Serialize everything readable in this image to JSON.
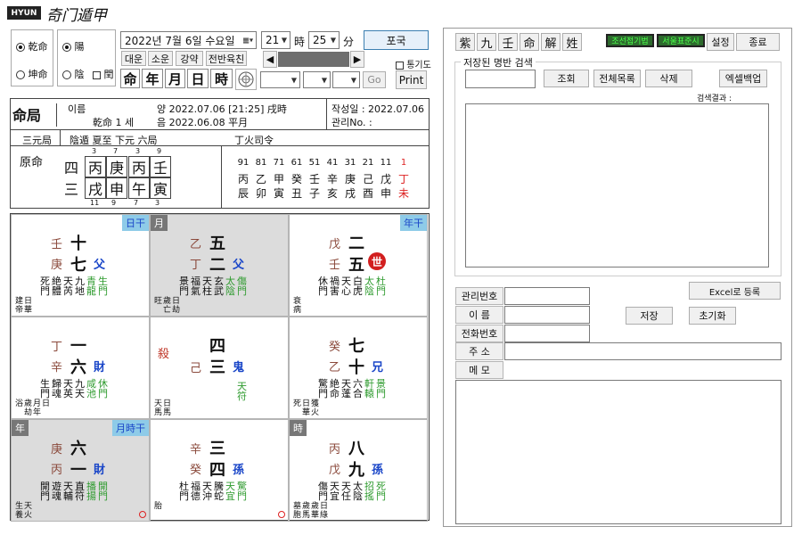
{
  "app": {
    "logo": "HYUN",
    "title": "奇门遁甲"
  },
  "radio": {
    "male": "乾命",
    "female": "坤命",
    "yang": "陽",
    "yin": "陰",
    "leap": "閏"
  },
  "date": {
    "value": "2022년  7월  6일 수요일",
    "hour": "21",
    "hour_unit": "時",
    "minute": "25",
    "minute_unit": "分"
  },
  "buttons": {
    "pokuk": "포국",
    "daewoon": "대운",
    "sowoon": "소운",
    "gangyak": "강약",
    "jeonban": "전반육친",
    "myeong": "命",
    "nyeon": "年",
    "wol": "月",
    "il": "日",
    "si": "時",
    "go": "Go",
    "print": "Print",
    "tonggi": "통기도"
  },
  "right_top": {
    "tabs": [
      "紫",
      "九",
      "壬",
      "命",
      "解",
      "姓"
    ],
    "green1": "조선접기법",
    "green2": "서울표준시",
    "settings": "설정",
    "exit": "종료"
  },
  "search": {
    "title": "저장된 명반 검색",
    "query": "조회",
    "all": "전체목록",
    "delete": "삭제",
    "excel_backup": "엑셀백업",
    "result_label": "검색결과 :"
  },
  "form": {
    "excel_register": "Excel로 등록",
    "save": "저장",
    "reset": "초기화",
    "fields": [
      "관리번호",
      "이    름",
      "전화번호",
      "주    소",
      "메    모"
    ]
  },
  "header": {
    "title": "命局",
    "name_label": "이름",
    "line1": "양 2022.07.06 [21:25] 戌時",
    "line2a": "乾命 1 세",
    "line2b": "음 2022.06.08 平月",
    "created": "작성일 : 2022.07.06",
    "manage": "관리No. :"
  },
  "row2": {
    "sanyuan": "三元局",
    "ju": "陰遁 夏至 下元 六局",
    "siling": "丁火司令"
  },
  "pillars": {
    "label": "原命",
    "top": [
      "四",
      "丙",
      "庚",
      "丙",
      "壬"
    ],
    "bottom": [
      "三",
      "戌",
      "申",
      "午",
      "寅"
    ],
    "top_nums": [
      "3",
      "7",
      "3",
      "9"
    ],
    "bottom_nums": [
      "11",
      "9",
      "7",
      "3"
    ]
  },
  "luck": {
    "ages": [
      "91",
      "81",
      "71",
      "61",
      "51",
      "41",
      "31",
      "21",
      "11",
      "1"
    ],
    "stems": [
      "丙",
      "乙",
      "甲",
      "癸",
      "壬",
      "辛",
      "庚",
      "己",
      "戊",
      "丁"
    ],
    "branches": [
      "辰",
      "卯",
      "寅",
      "丑",
      "子",
      "亥",
      "戌",
      "酉",
      "申",
      "未"
    ]
  },
  "palaces": [
    {
      "tags": [
        "日干"
      ],
      "s1": "壬",
      "s2": "庚",
      "n1": "十",
      "n2": "七",
      "rel": "父",
      "cols": [
        [
          "死",
          "門"
        ],
        [
          "絶",
          "體"
        ],
        [
          "天",
          "芮"
        ],
        [
          "九",
          "地"
        ],
        [
          "青",
          "龍"
        ],
        [
          "生",
          "門"
        ]
      ],
      "bottom": [
        [
          "建",
          "帝"
        ],
        [
          "日",
          "華"
        ]
      ]
    },
    {
      "tags": [
        "月"
      ],
      "s1": "乙",
      "s2": "丁",
      "n1": "五",
      "n2": "二",
      "rel": "父",
      "cols": [
        [
          "景",
          "門"
        ],
        [
          "福",
          "氣"
        ],
        [
          "天",
          "柱"
        ],
        [
          "玄",
          "武"
        ],
        [
          "太",
          "陰"
        ],
        [
          "傷",
          "門"
        ]
      ],
      "bottom": [
        [
          "旺",
          ""
        ],
        [
          "歲",
          "亡"
        ],
        [
          "日",
          "劫"
        ]
      ]
    },
    {
      "tags": [
        "年干"
      ],
      "s1": "戊",
      "s2": "壬",
      "n1": "二",
      "n2": "五",
      "rel": "世",
      "cols": [
        [
          "休",
          "門"
        ],
        [
          "禍",
          "害"
        ],
        [
          "天",
          "心"
        ],
        [
          "白",
          "虎"
        ],
        [
          "太",
          "陰"
        ],
        [
          "杜",
          "門"
        ]
      ],
      "bottom": [
        [
          "衰",
          "病"
        ]
      ]
    },
    {
      "tags": [],
      "s1": "丁",
      "s2": "辛",
      "n1": "一",
      "n2": "六",
      "rel": "財",
      "cols": [
        [
          "生",
          "門"
        ],
        [
          "歸",
          "魂"
        ],
        [
          "天",
          "英"
        ],
        [
          "九",
          "天"
        ],
        [
          "咸",
          "池"
        ],
        [
          "休",
          "門"
        ]
      ],
      "bottom": [
        [
          "浴",
          ""
        ],
        [
          "歲",
          "劫"
        ],
        [
          "月",
          "年"
        ],
        [
          "日",
          ""
        ]
      ]
    },
    {
      "tags": [],
      "s1": "殺",
      "s2": "己",
      "n1": "四",
      "n2": "三",
      "rel": "鬼",
      "cols": [
        [
          "天",
          "符"
        ]
      ],
      "bottom": [
        [
          "天",
          "馬"
        ],
        [
          "日",
          "馬"
        ]
      ]
    },
    {
      "tags": [],
      "s1": "癸",
      "s2": "乙",
      "n1": "七",
      "n2": "十",
      "rel": "兄",
      "cols": [
        [
          "驚",
          "門"
        ],
        [
          "絶",
          "命"
        ],
        [
          "天",
          "蓬"
        ],
        [
          "六",
          "合"
        ],
        [
          "軒",
          "轅"
        ],
        [
          "景",
          "門"
        ]
      ],
      "bottom": [
        [
          "死",
          ""
        ],
        [
          "日",
          "華"
        ],
        [
          "獲",
          "火"
        ]
      ]
    },
    {
      "tags": [
        "年",
        "月時干"
      ],
      "s1": "庚",
      "s2": "丙",
      "n1": "六",
      "n2": "一",
      "rel": "財",
      "cols": [
        [
          "開",
          "門"
        ],
        [
          "遊",
          "魂"
        ],
        [
          "天",
          "輔"
        ],
        [
          "直",
          "符"
        ],
        [
          "播",
          "揚"
        ],
        [
          "開",
          "門"
        ]
      ],
      "bottom": [
        [
          "生",
          "養"
        ],
        [
          "天",
          "火"
        ]
      ]
    },
    {
      "tags": [],
      "s1": "辛",
      "s2": "癸",
      "n1": "三",
      "n2": "四",
      "rel": "孫",
      "cols": [
        [
          "杜",
          "門"
        ],
        [
          "福",
          "德"
        ],
        [
          "天",
          "沖"
        ],
        [
          "騰",
          "蛇"
        ],
        [
          "天",
          "宜"
        ],
        [
          "驚",
          "門"
        ]
      ],
      "bottom": [
        [
          "胎",
          ""
        ]
      ]
    },
    {
      "tags": [
        "時"
      ],
      "s1": "丙",
      "s2": "戊",
      "n1": "八",
      "n2": "九",
      "rel": "孫",
      "cols": [
        [
          "傷",
          "門"
        ],
        [
          "天",
          "宜"
        ],
        [
          "天",
          "任"
        ],
        [
          "太",
          "陰"
        ],
        [
          "招",
          "搖"
        ],
        [
          "死",
          "門"
        ]
      ],
      "bottom": [
        [
          "墓",
          "胞"
        ],
        [
          "歲",
          "馬"
        ],
        [
          "歲",
          "華"
        ],
        [
          "日",
          "綠"
        ]
      ]
    }
  ]
}
